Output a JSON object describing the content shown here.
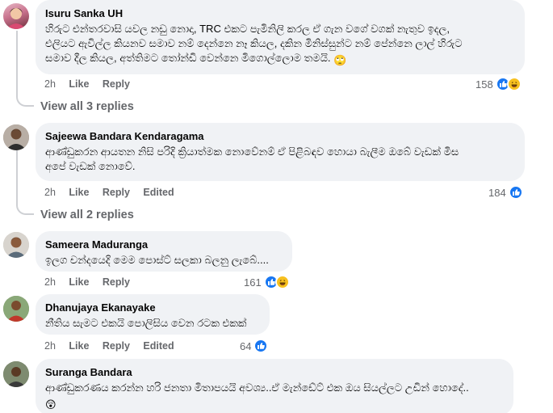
{
  "comments": [
    {
      "author": "Isuru Sanka UH",
      "text": "හිරුට එන්තරවාසි යවල නඩු නොදා, TRC එකට පැමිනිලි කරල ඒ ගැන වගේ වගක් නැතුව ඉදල,\nඑලියට ඇවිල්ල කියනව සමාව නම් දෙන්නෙ නෑ කියල, දකින මිනිස්සුන්ට නම් පේන්නෙ ලාල් හිරුට\nසමාව දීල කියල, අත්තිමට තෝන්ඩි වෙන්නෙ මිගොල්ලොම තමයි.",
      "emoji": "🙄",
      "time": "2h",
      "like": "Like",
      "reply": "Reply",
      "edited": "",
      "reaction_count": "158",
      "reactions": [
        "like",
        "haha"
      ],
      "view_replies": "View all 3 replies"
    },
    {
      "author": "Sajeewa Bandara Kendaragama",
      "text": "ආණ්ඩුකරන ආයතන නිසි පරිදි ක්‍රියාත්මක නොවේනම් ඒ පිළිබඳව හොයා බැලීම ඔබේ වැඩක් මිස\nඅපේ වැඩක් නොවේ.",
      "emoji": "",
      "time": "2h",
      "like": "Like",
      "reply": "Reply",
      "edited": "Edited",
      "reaction_count": "184",
      "reactions": [
        "like"
      ],
      "view_replies": "View all 2 replies"
    },
    {
      "author": "Sameera Maduranga",
      "text": "ඉලග චන්දයෙදි මෙම පොස්ට් සලකා බලනු ලැබේ....",
      "emoji": "",
      "time": "2h",
      "like": "Like",
      "reply": "Reply",
      "edited": "",
      "reaction_count": "161",
      "reactions": [
        "like",
        "haha"
      ],
      "view_replies": ""
    },
    {
      "author": "Dhanujaya Ekanayake",
      "text": "නීතිය සැමට එකයි පොලිසිය වෙන රටක එකක්",
      "emoji": "",
      "time": "2h",
      "like": "Like",
      "reply": "Reply",
      "edited": "Edited",
      "reaction_count": "64",
      "reactions": [
        "like"
      ],
      "view_replies": ""
    },
    {
      "author": "Suranga Bandara",
      "text": "ආණ්ඩුකරණය කරන්න හරි ජනතා මිතාපයයි අවශ්‍ය..ඒ මැන්ඩේට් එක ඔය සියල්ලට උඩින් හොදේ..",
      "emoji": "😲",
      "time": "",
      "like": "",
      "reply": "",
      "edited": "",
      "reaction_count": "",
      "reactions": [],
      "view_replies": ""
    }
  ],
  "colors": {
    "bubble_bg": "#f0f2f5",
    "meta_text": "#65676b",
    "like_blue": "#1877f2",
    "haha_yellow": "#f7c01f"
  },
  "icons": {
    "like": "thumbs-up-icon",
    "haha": "laughing-face-icon"
  }
}
